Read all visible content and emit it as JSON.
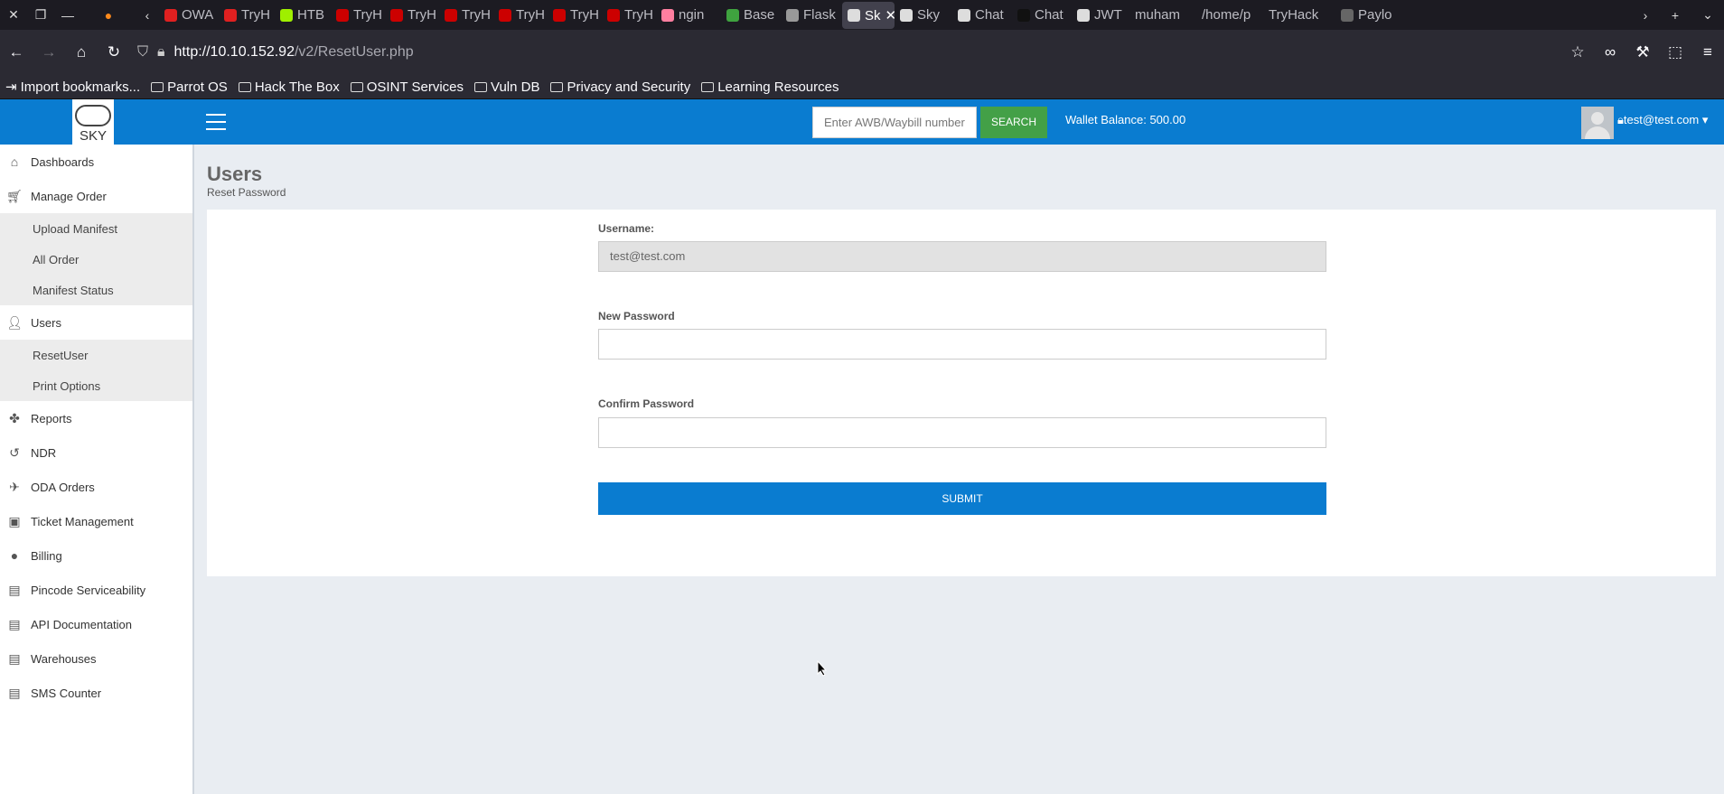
{
  "browser": {
    "tabs": [
      {
        "label": "OWA",
        "color": "#e02020"
      },
      {
        "label": "TryH",
        "color": "#e02020"
      },
      {
        "label": "HTB",
        "color": "#9fef00"
      },
      {
        "label": "TryH",
        "color": "#c00"
      },
      {
        "label": "TryH",
        "color": "#c00"
      },
      {
        "label": "TryH",
        "color": "#c00"
      },
      {
        "label": "TryH",
        "color": "#c00"
      },
      {
        "label": "TryH",
        "color": "#c00"
      },
      {
        "label": "TryH",
        "color": "#c00"
      },
      {
        "label": "ngin",
        "color": "#ff7fa0"
      },
      {
        "label": "Base",
        "color": "#3fa33f"
      },
      {
        "label": "Flask",
        "color": "#999"
      },
      {
        "label": "Sk",
        "color": "#ddd",
        "active": true
      },
      {
        "label": "Sky",
        "color": "#ddd"
      },
      {
        "label": "Chat",
        "color": "#ddd"
      },
      {
        "label": "Chat",
        "color": "#111"
      },
      {
        "label": "JWT",
        "color": "#ddd"
      },
      {
        "label": "muham",
        "color": ""
      },
      {
        "label": "/home/p",
        "color": ""
      },
      {
        "label": "TryHack",
        "color": ""
      },
      {
        "label": "Paylo",
        "color": "#666"
      }
    ],
    "url_host": "http://10.10.152.92",
    "url_path": "/v2/ResetUser.php",
    "bookmarks": [
      "Import bookmarks...",
      "Parrot OS",
      "Hack The Box",
      "OSINT Services",
      "Vuln DB",
      "Privacy and Security",
      "Learning Resources"
    ]
  },
  "header": {
    "logo_text": "SKY",
    "awb_placeholder": "Enter AWB/Waybill number",
    "search_label": "SEARCH",
    "wallet": "Wallet Balance: 500.00",
    "user": "test@test.com"
  },
  "sidebar": {
    "items": [
      {
        "label": "Dashboards",
        "icon": "home-icon"
      },
      {
        "label": "Manage Order",
        "icon": "cart-icon",
        "children": [
          "Upload Manifest",
          "All Order",
          "Manifest Status"
        ]
      },
      {
        "label": "Users",
        "icon": "user-icon",
        "children": [
          "ResetUser",
          "Print Options"
        ]
      },
      {
        "label": "Reports",
        "icon": "fan-icon"
      },
      {
        "label": "NDR",
        "icon": "undo-icon"
      },
      {
        "label": "ODA Orders",
        "icon": "plane-icon"
      },
      {
        "label": "Ticket Management",
        "icon": "ticket-icon"
      },
      {
        "label": "Billing",
        "icon": "circle-icon"
      },
      {
        "label": "Pincode Serviceability",
        "icon": "briefcase-icon"
      },
      {
        "label": "API Documentation",
        "icon": "briefcase-icon"
      },
      {
        "label": "Warehouses",
        "icon": "briefcase-icon"
      },
      {
        "label": "SMS Counter",
        "icon": "briefcase-icon"
      }
    ]
  },
  "main": {
    "title": "Users",
    "subtitle": "Reset Password",
    "username_label": "Username:",
    "username_value": "test@test.com",
    "new_password_label": "New Password",
    "confirm_password_label": "Confirm Password",
    "submit_label": "SUBMIT"
  }
}
